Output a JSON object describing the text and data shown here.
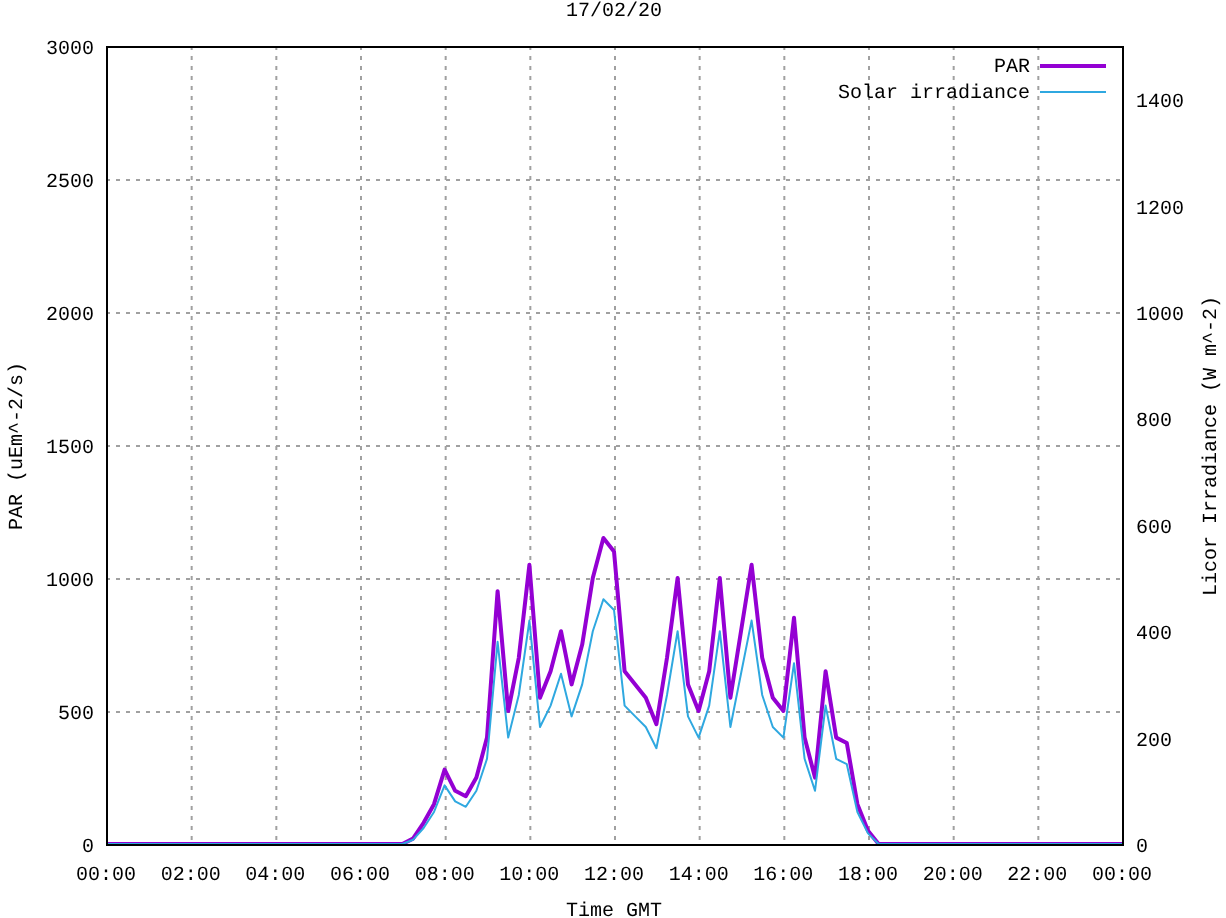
{
  "chart_data": {
    "type": "line",
    "title": "17/02/20",
    "xlabel": "Time GMT",
    "ylabel": "PAR (uEm^-2/s)",
    "y2label": "Licor Irradiance (W m^-2)",
    "x": [
      0,
      6,
      7,
      7.25,
      7.5,
      7.75,
      8,
      8.25,
      8.5,
      8.75,
      9,
      9.25,
      9.5,
      9.75,
      10,
      10.25,
      10.5,
      10.75,
      11,
      11.25,
      11.5,
      11.75,
      12,
      12.25,
      12.5,
      12.75,
      13,
      13.25,
      13.5,
      13.75,
      14,
      14.25,
      14.5,
      14.75,
      15,
      15.25,
      15.5,
      15.75,
      16,
      16.25,
      16.5,
      16.75,
      17,
      17.25,
      17.5,
      17.75,
      18,
      18.25,
      24
    ],
    "grid": true,
    "legend": true,
    "xlim": [
      0,
      24
    ],
    "ylim": [
      0,
      3000
    ],
    "y2lim": [
      0,
      1500
    ],
    "xticks": [
      {
        "value": 0,
        "label": "00:00"
      },
      {
        "value": 2,
        "label": "02:00"
      },
      {
        "value": 4,
        "label": "04:00"
      },
      {
        "value": 6,
        "label": "06:00"
      },
      {
        "value": 8,
        "label": "08:00"
      },
      {
        "value": 10,
        "label": "10:00"
      },
      {
        "value": 12,
        "label": "12:00"
      },
      {
        "value": 14,
        "label": "14:00"
      },
      {
        "value": 16,
        "label": "16:00"
      },
      {
        "value": 18,
        "label": "18:00"
      },
      {
        "value": 20,
        "label": "20:00"
      },
      {
        "value": 22,
        "label": "22:00"
      },
      {
        "value": 24,
        "label": "00:00"
      }
    ],
    "yticks": [
      0,
      500,
      1000,
      1500,
      2000,
      2500,
      3000
    ],
    "y2ticks": [
      0,
      200,
      400,
      600,
      800,
      1000,
      1200,
      1400
    ],
    "series": [
      {
        "name": "PAR",
        "color": "#9400d3",
        "axis": "y",
        "values": [
          0,
          0,
          0,
          20,
          80,
          150,
          280,
          200,
          180,
          250,
          400,
          950,
          500,
          700,
          1050,
          550,
          650,
          800,
          600,
          750,
          1000,
          1150,
          1100,
          650,
          600,
          550,
          450,
          700,
          1000,
          600,
          500,
          650,
          1000,
          550,
          800,
          1050,
          700,
          550,
          500,
          850,
          400,
          250,
          650,
          400,
          380,
          150,
          50,
          0,
          0
        ]
      },
      {
        "name": "Solar irradiance",
        "color": "#2fa8e0",
        "axis": "y2",
        "values": [
          0,
          0,
          0,
          8,
          30,
          60,
          110,
          80,
          70,
          100,
          160,
          380,
          200,
          280,
          420,
          220,
          260,
          320,
          240,
          300,
          400,
          460,
          440,
          260,
          240,
          220,
          180,
          280,
          400,
          240,
          200,
          260,
          400,
          220,
          320,
          420,
          280,
          220,
          200,
          340,
          160,
          100,
          260,
          160,
          150,
          60,
          20,
          0,
          0
        ]
      }
    ]
  }
}
